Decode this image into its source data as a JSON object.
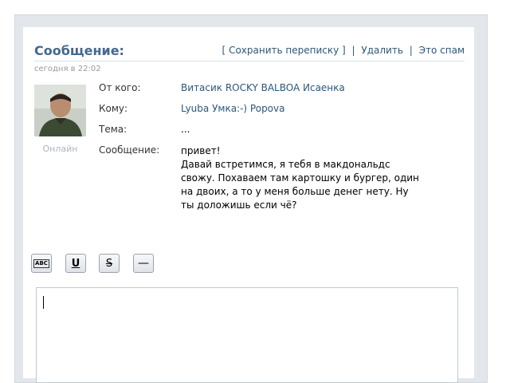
{
  "header": {
    "title": "Сообщение:",
    "date": "сегодня в 22:02",
    "actions": {
      "open_bracket": "[",
      "save": "Сохранить переписку",
      "close_bracket": "]",
      "sep1": "|",
      "delete": "Удалить",
      "sep2": "|",
      "spam": "Это спам"
    }
  },
  "sender": {
    "status": "Онлайн",
    "avatar_icon": "user-avatar-photo"
  },
  "fields": {
    "from_label": "От кого:",
    "from_value": "Витасик ROCKY BALBOA Исаенка",
    "to_label": "Кому:",
    "to_value": "Lyuba Умка:-) Popova",
    "subject_label": "Тема:",
    "subject_value": "...",
    "message_label": "Сообщение:"
  },
  "message": {
    "line1": "привет!",
    "line2": "Давай встретимся, я тебя в макдональдс",
    "line3": "свожу. Похаваем там картошку и бургер, один",
    "line4": "на двоих, а то у меня больше денег нету. Ну",
    "line5": "ты доложишь если чё?"
  },
  "toolbar": {
    "spellcheck_icon": "ABC",
    "underline_icon": "U",
    "strike_icon": "S",
    "hr_icon": "—"
  },
  "reply": {
    "value": ""
  }
}
